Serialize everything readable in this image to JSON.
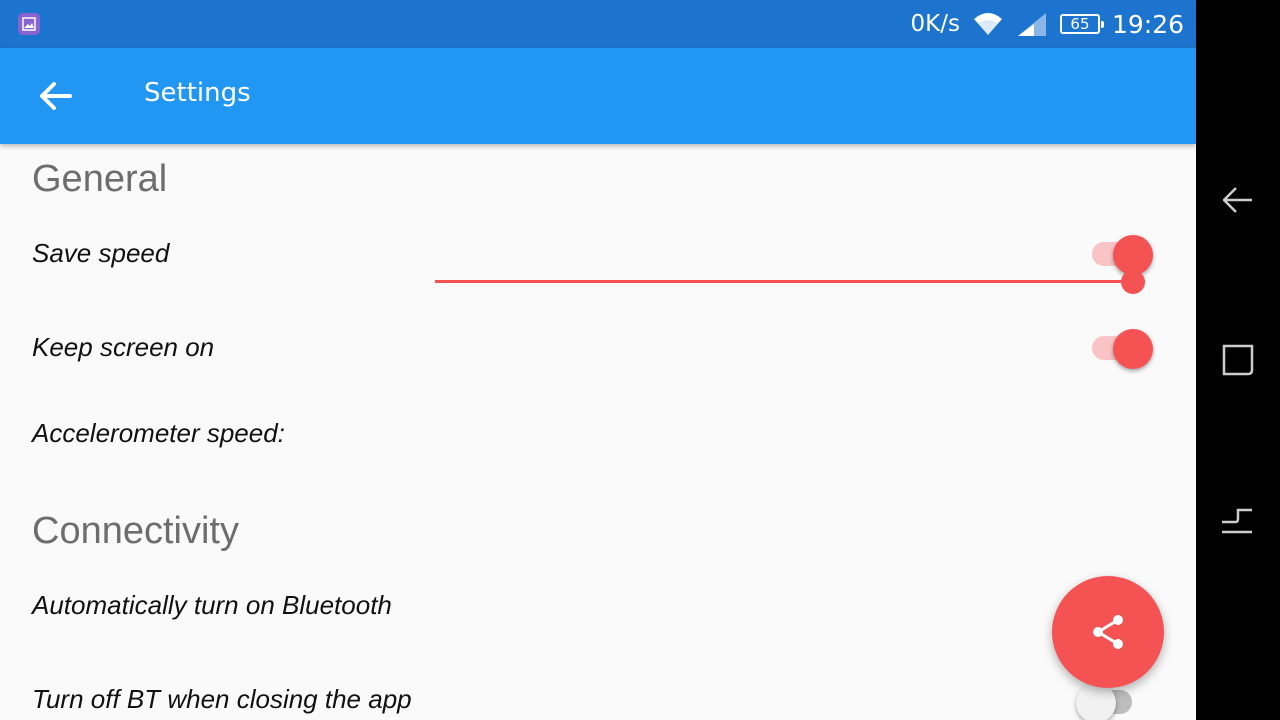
{
  "status_bar": {
    "network_speed": "0K/s",
    "battery_level": "65",
    "time": "19:26",
    "icons": [
      "gallery-icon",
      "wifi-icon",
      "cell-signal-icon",
      "battery-icon"
    ]
  },
  "app_bar": {
    "title": "Settings",
    "back_icon": "arrow-back-icon",
    "color": "#2196f3"
  },
  "sections": {
    "general": {
      "header": "General",
      "save_speed": {
        "label": "Save speed",
        "checked": true
      },
      "keep_screen_on": {
        "label": "Keep screen on",
        "checked": true
      },
      "accelerometer_speed": {
        "label": "Accelerometer speed:",
        "value_fraction": 1.0
      }
    },
    "connectivity": {
      "header": "Connectivity",
      "auto_bluetooth": {
        "label": "Automatically turn on Bluetooth",
        "checked": true
      },
      "turn_off_bt": {
        "label": "Turn off BT when closing the app",
        "checked": false
      }
    }
  },
  "fab": {
    "icon": "share-icon",
    "color": "#f55254"
  },
  "nav_bar": {
    "icons": [
      "nav-back-icon",
      "nav-recents-icon",
      "nav-menu-icon"
    ]
  },
  "colors": {
    "accent": "#f55254",
    "status_bar": "#1c74cf",
    "background": "#fafafa"
  }
}
